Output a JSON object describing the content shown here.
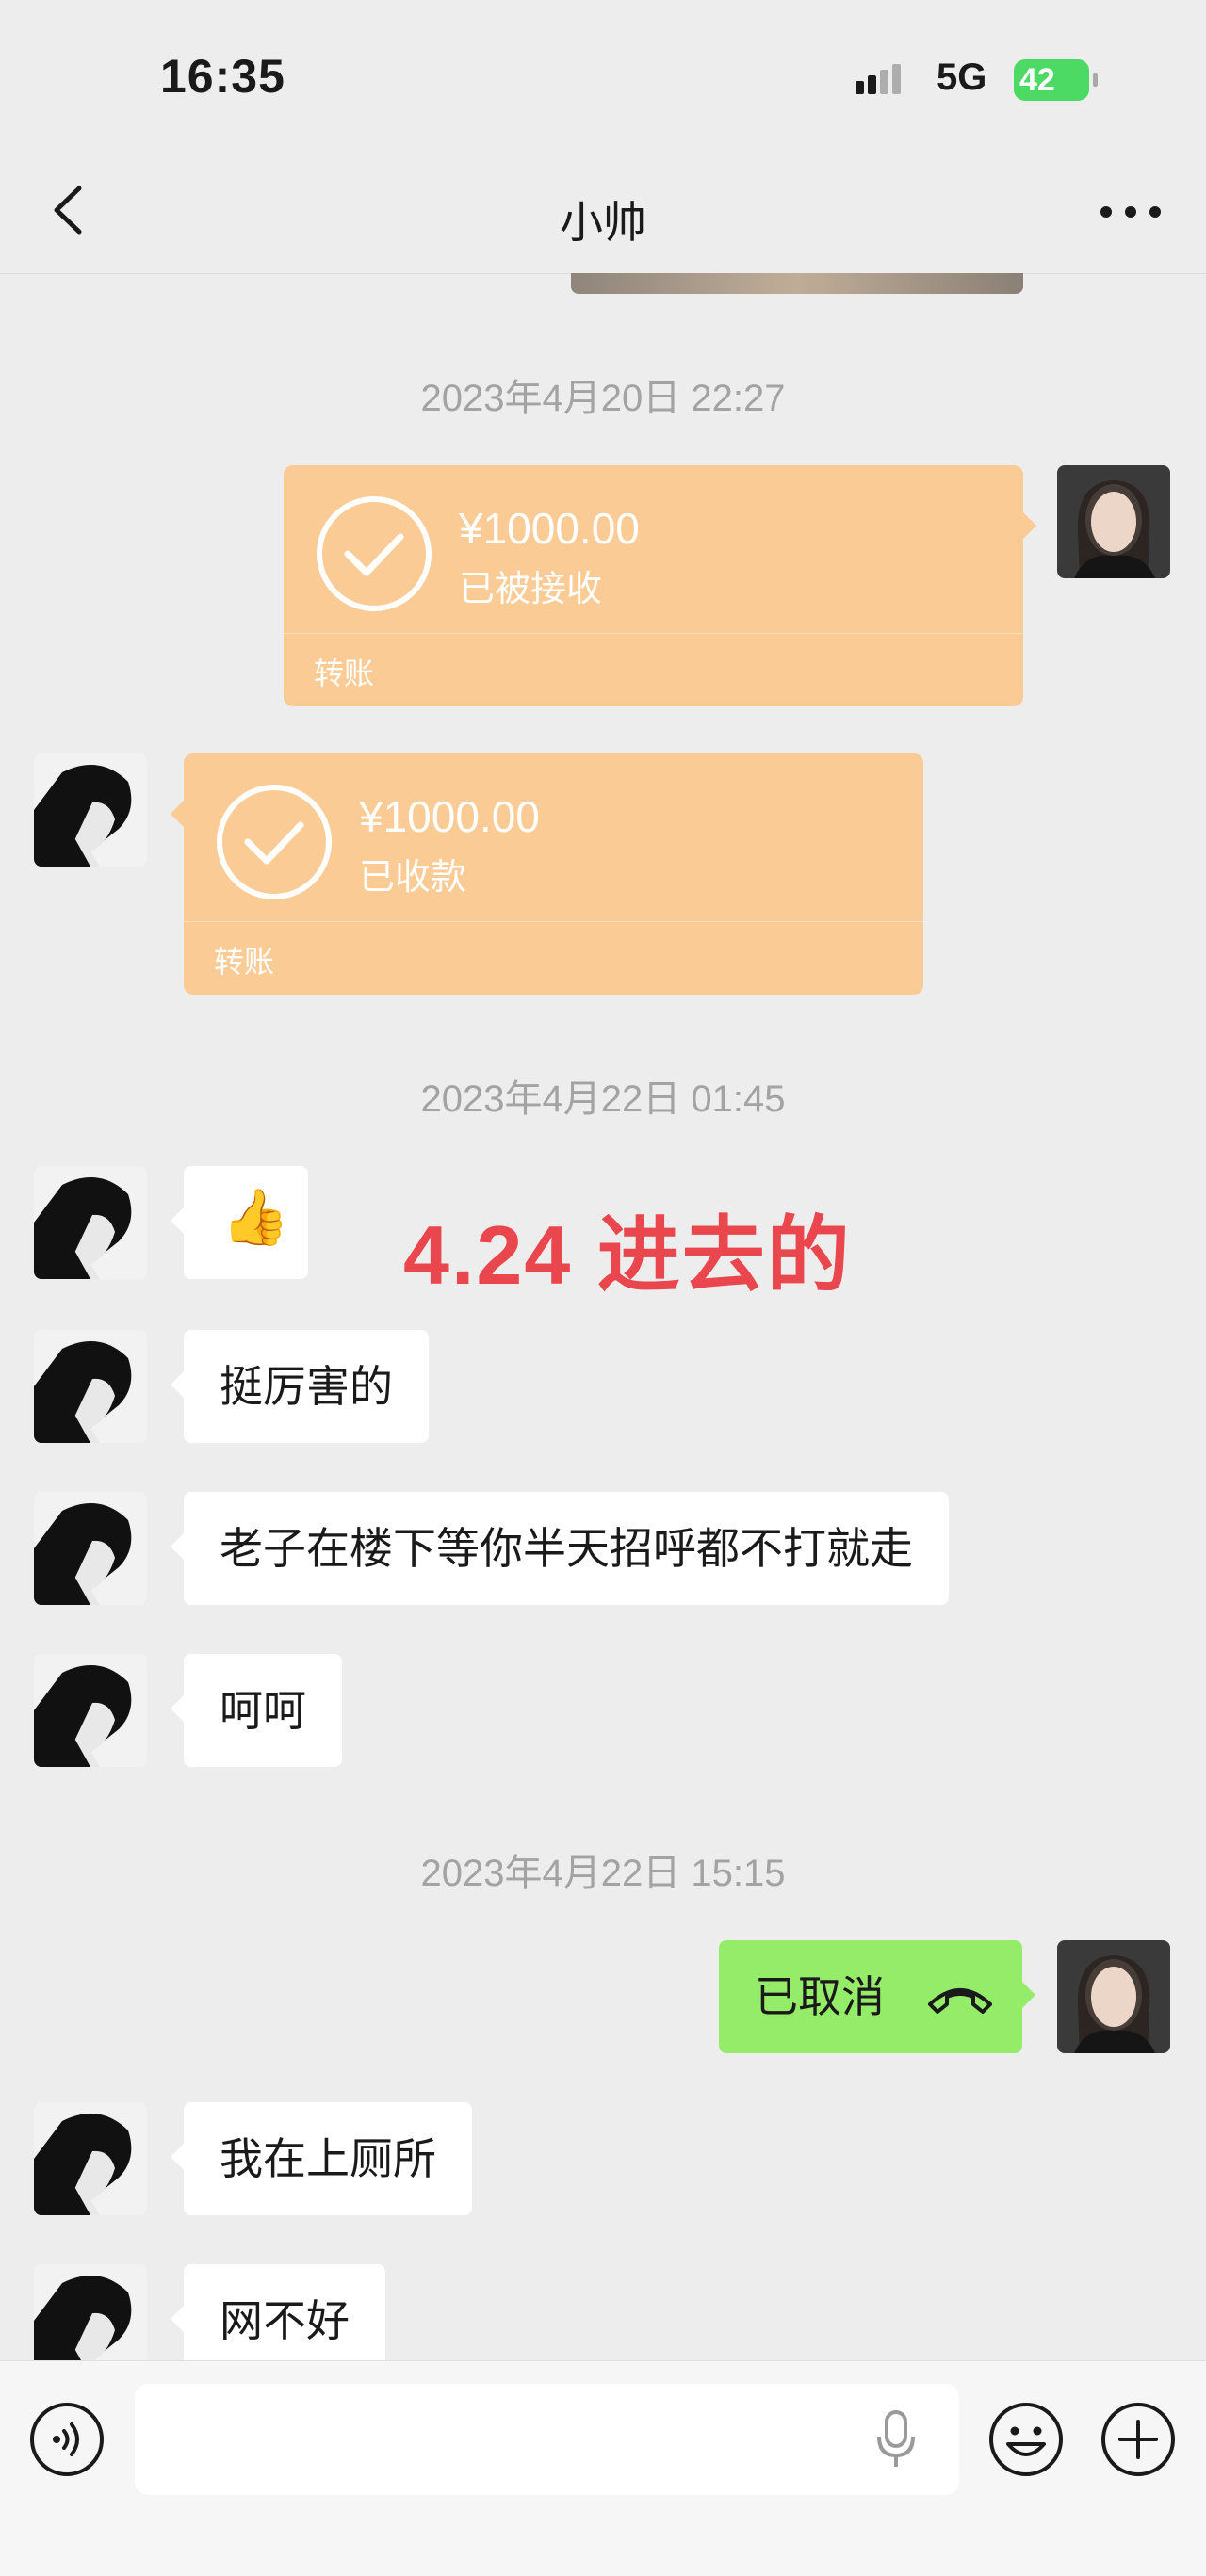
{
  "status_bar": {
    "time": "16:35",
    "network": "5G",
    "battery": "42"
  },
  "header": {
    "title": "小帅"
  },
  "timestamps": {
    "t1": "2023年4月20日 22:27",
    "t2": "2023年4月22日 01:45",
    "t3": "2023年4月22日 15:15"
  },
  "transfers": [
    {
      "amount": "¥1000.00",
      "status": "已被接收",
      "type": "转账"
    },
    {
      "amount": "¥1000.00",
      "status": "已收款",
      "type": "转账"
    }
  ],
  "annotation": "4.24 进去的",
  "messages": {
    "thumb": "👍",
    "m1": "挺厉害的",
    "m2": "老子在楼下等你半天招呼都不打就走",
    "m3": "呵呵",
    "call": "已取消",
    "m4": "我在上厕所",
    "m5": "网不好"
  },
  "input": {
    "placeholder": ""
  },
  "colors": {
    "transfer": "#facb95",
    "sent": "#95ec69",
    "annotation": "#e9464d",
    "battery": "#4cd964"
  },
  "icons": [
    "back-arrow-icon",
    "more-icon",
    "check-circle-icon",
    "hangup-icon",
    "voice-icon",
    "mic-icon",
    "emoji-icon",
    "plus-icon"
  ]
}
